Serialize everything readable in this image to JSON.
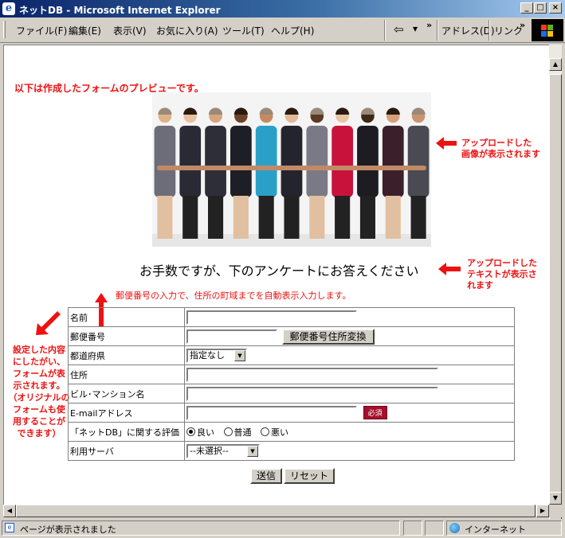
{
  "window": {
    "title": "ネットDB - Microsoft Internet Explorer",
    "minimize": "_",
    "maximize": "□",
    "close": "×"
  },
  "menu": {
    "items": [
      "ファイル(F)",
      "編集(E)",
      "表示(V)",
      "お気に入り(A)",
      "ツール(T)",
      "ヘルプ(H)"
    ],
    "back": "⇦",
    "back_dropdown": "▾",
    "more": "»",
    "address": "アドレス(D)",
    "links": "リンク",
    "more2": "»"
  },
  "page": {
    "intro": "以下は作成したフォームのプレビューです。",
    "photo_caption": [
      "アップロードした",
      "画像が表示されます"
    ],
    "survey_heading": "お手数ですが、下のアンケートにお答えください",
    "text_caption": [
      "アップロードした",
      "テキストが表示さ",
      "れます"
    ],
    "zip_note": "郵便番号の入力で、住所の町域までを自動表示入力します。",
    "left_note": [
      "設定した内容",
      "にしたがい、",
      "フォームが表",
      "示されます。",
      "（オリジナルの",
      "フォームも使",
      "用することが",
      "できます）"
    ]
  },
  "form": {
    "name_label": "名前",
    "zip_label": "郵便番号",
    "zip_button": "郵便番号住所変換",
    "pref_label": "都道府県",
    "pref_value": "指定なし",
    "address_label": "住所",
    "building_label": "ビル･マンション名",
    "email_label": "E-mailアドレス",
    "required_badge": "必須",
    "rating_label": "「ネットDB」に関する評価",
    "rating_options": [
      "良い",
      "普通",
      "悪い"
    ],
    "rating_selected": 0,
    "server_label": "利用サーバ",
    "server_value": "--未選択--",
    "submit": "送信",
    "reset": "リセット"
  },
  "status": {
    "message": "ページが表示されました",
    "zone": "インターネット"
  },
  "colors": {
    "accent_red": "#ee1111",
    "badge": "#a50f2d",
    "titlebar_start": "#0a246a",
    "titlebar_end": "#a6caf0"
  }
}
